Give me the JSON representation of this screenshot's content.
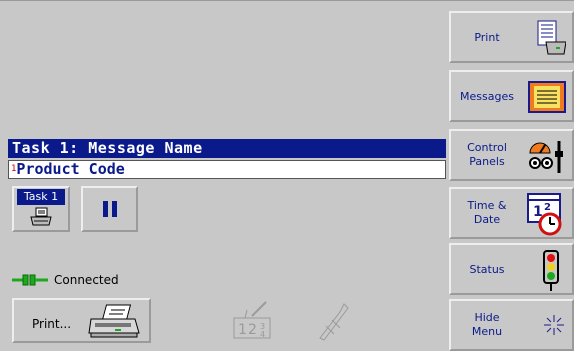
{
  "task_panel": {
    "title": "Task 1: Message Name",
    "product_field": {
      "index": "1",
      "value": "Product Code"
    },
    "task_button_label": "Task 1",
    "pause_button": "pause"
  },
  "status": {
    "connection_text": "Connected"
  },
  "bottom": {
    "print_label": "Print..."
  },
  "menu": {
    "print": "Print",
    "messages": "Messages",
    "control_panels_1": "Control",
    "control_panels_2": "Panels",
    "time_date_1": "Time &",
    "time_date_2": "Date",
    "status": "Status",
    "hide_menu_1": "Hide",
    "hide_menu_2": "Menu"
  },
  "icons": {
    "print": "printer-document-icon",
    "messages": "message-document-icon",
    "control_panels": "gauges-icon",
    "time_date": "calendar-clock-icon",
    "status": "traffic-light-icon",
    "hide_menu": "sparkle-icon",
    "connected": "plug-connector-icon",
    "task": "small-printer-icon",
    "numbers": "numbers-icon",
    "tools": "tools-icon"
  },
  "colors": {
    "title_bar": "#0a1a8a",
    "background": "#c8c8c8",
    "menu_text": "#0a1a8a"
  }
}
